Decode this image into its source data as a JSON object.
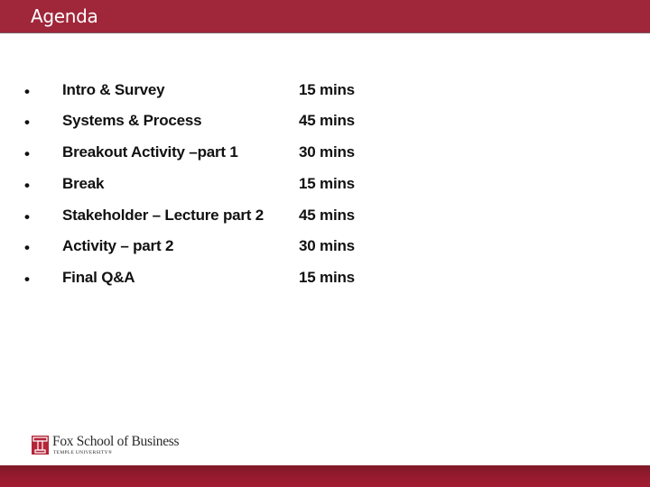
{
  "header": {
    "title": "Agenda"
  },
  "agenda": {
    "bullet": "•",
    "items": [
      {
        "label": "Intro & Survey",
        "duration": "15 mins"
      },
      {
        "label": "Systems & Process",
        "duration": "45 mins"
      },
      {
        "label": "Breakout Activity –part 1",
        "duration": "30 mins"
      },
      {
        "label": "Break",
        "duration": "15 mins"
      },
      {
        "label": "Stakeholder – Lecture part 2",
        "duration": "45 mins"
      },
      {
        "label": "Activity – part 2",
        "duration": "30 mins"
      },
      {
        "label": "Final Q&A",
        "duration": "15 mins"
      }
    ]
  },
  "footer_logo": {
    "icon": "temple-t-icon",
    "name": "Fox School of Business",
    "subtitle": "TEMPLE UNIVERSITY®"
  },
  "colors": {
    "header_bg": "#a0263a",
    "footer_bg": "#951a2d",
    "logo_red": "#b5253a",
    "text": "#111111"
  }
}
